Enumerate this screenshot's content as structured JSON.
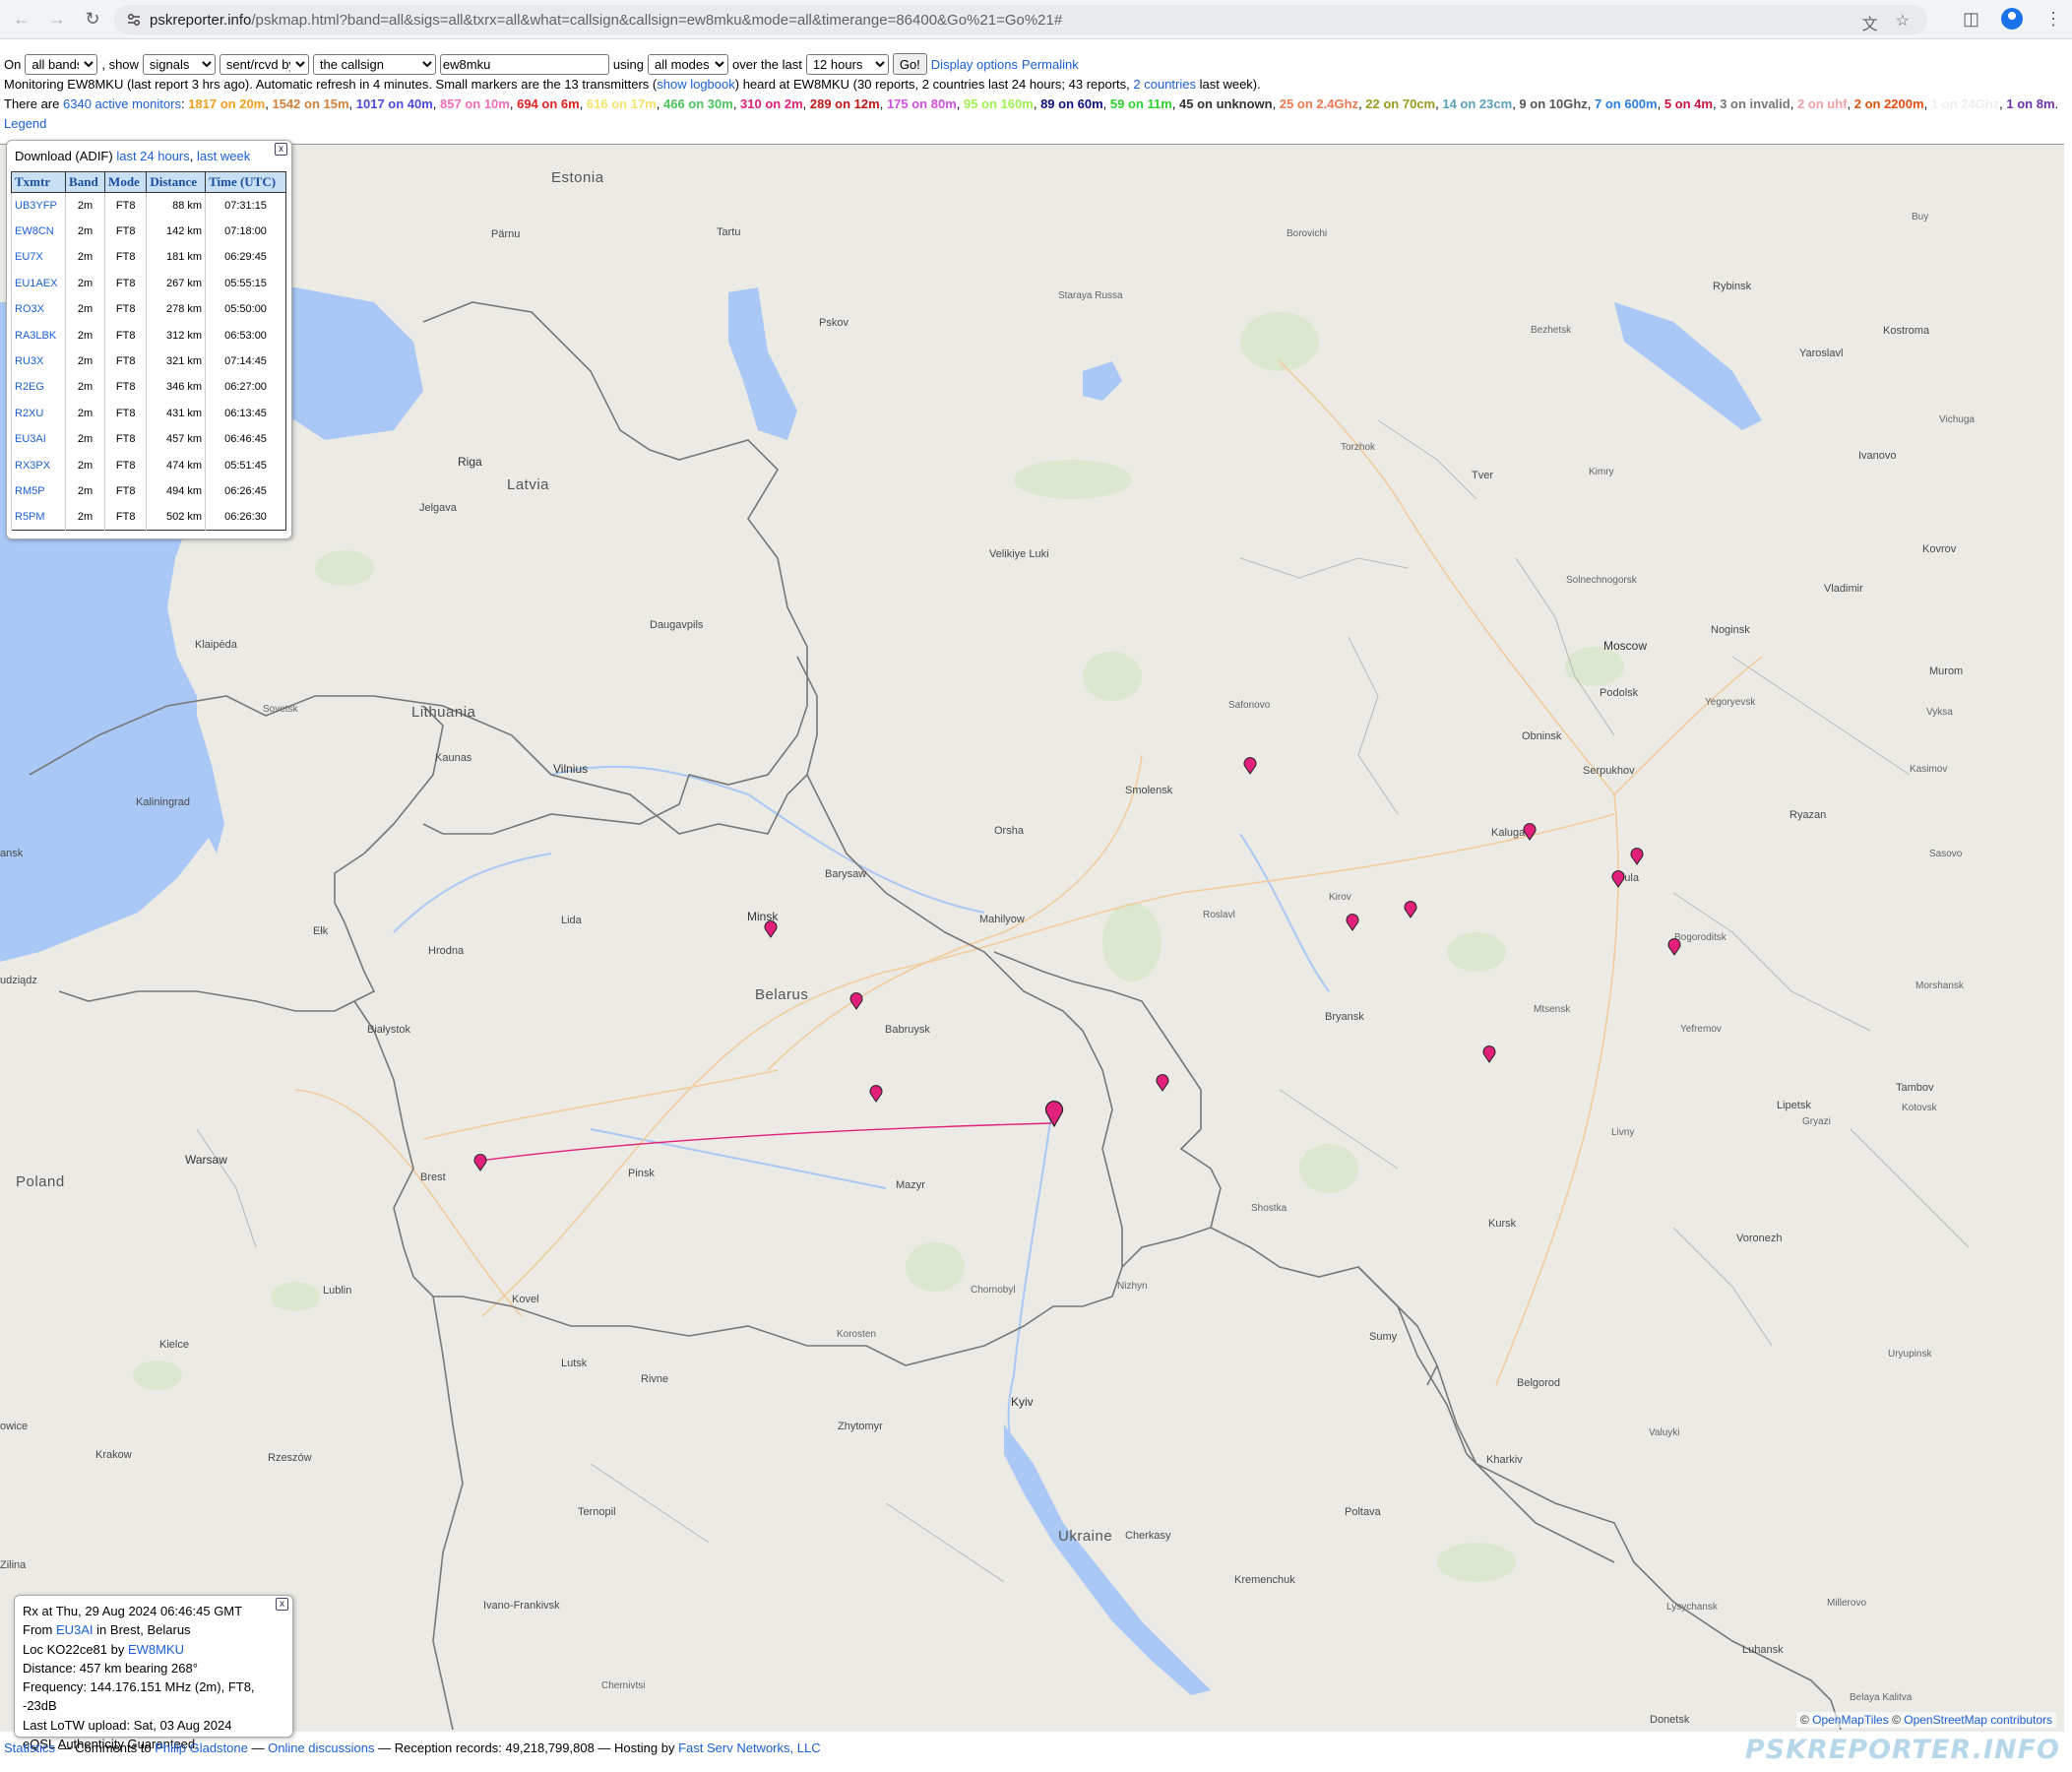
{
  "browser": {
    "url_host": "pskreporter.info",
    "url_path": "/pskmap.html?band=all&sigs=all&txrx=all&what=callsign&callsign=ew8mku&mode=all&timerange=86400&Go%21=Go%21#"
  },
  "controls": {
    "on_label": "On",
    "band_value": "all bands",
    "show_label": ", show",
    "sigs_value": "signals",
    "txrx_value": "sent/rcvd by",
    "what_value": "the callsign",
    "callsign_value": "ew8mku",
    "using_label": "using",
    "mode_value": "all modes",
    "over_label": "over the last",
    "timerange_value": "12 hours",
    "go_label": "Go!",
    "display_options": "Display options",
    "permalink": "Permalink"
  },
  "status": {
    "monitoring_prefix": "Monitoring EW8MKU (last report 3 hrs ago). Automatic refresh in 4 minutes. Small markers are the 13 transmitters (",
    "show_logbook": "show logbook",
    "monitoring_mid": ") heard at EW8MKU (30 reports, 2 countries last 24 hours; 43 reports,",
    "countries_link": "2 countries",
    "monitoring_suffix": "last week).",
    "there_are": "There are",
    "active_monitors": "6340 active monitors",
    "legend": "Legend"
  },
  "band_counts": [
    {
      "text": "1817 on 20m",
      "color": "#f0a020"
    },
    {
      "text": "1542 on 15m",
      "color": "#d0803a"
    },
    {
      "text": "1017 on 40m",
      "color": "#4b4bd8"
    },
    {
      "text": "857 on 10m",
      "color": "#f06dbb"
    },
    {
      "text": "694 on 6m",
      "color": "#e02020"
    },
    {
      "text": "616 on 17m",
      "color": "#f3e36a"
    },
    {
      "text": "466 on 30m",
      "color": "#4cc25a"
    },
    {
      "text": "310 on 2m",
      "color": "#e0207a"
    },
    {
      "text": "289 on 12m",
      "color": "#c01818"
    },
    {
      "text": "175 on 80m",
      "color": "#d050e0"
    },
    {
      "text": "95 on 160m",
      "color": "#a0f050"
    },
    {
      "text": "89 on 60m",
      "color": "#101080"
    },
    {
      "text": "59 on 11m",
      "color": "#30d030"
    },
    {
      "text": "45 on unknown",
      "color": "#333333"
    },
    {
      "text": "25 on 2.4Ghz",
      "color": "#f07850"
    },
    {
      "text": "22 on 70cm",
      "color": "#9a9a20"
    },
    {
      "text": "14 on 23cm",
      "color": "#5aa0b8"
    },
    {
      "text": "9 on 10Ghz",
      "color": "#555555"
    },
    {
      "text": "7 on 600m",
      "color": "#2e7fe0"
    },
    {
      "text": "5 on 4m",
      "color": "#cc1040"
    },
    {
      "text": "3 on invalid",
      "color": "#777777"
    },
    {
      "text": "2 on uhf",
      "color": "#f0a0a8"
    },
    {
      "text": "2 on 2200m",
      "color": "#e05010"
    },
    {
      "text": "1 on 24Ghz",
      "color": "#eeeeee"
    },
    {
      "text": "1 on 8m",
      "color": "#7030b0"
    }
  ],
  "download_panel": {
    "label": "Download (ADIF)",
    "link_24h": "last 24 hours",
    "link_week": "last week",
    "close": "x",
    "columns": [
      "Txmtr",
      "Band",
      "Mode",
      "Distance",
      "Time (UTC)"
    ],
    "rows": [
      [
        "UB3YFP",
        "2m",
        "FT8",
        "88 km",
        "07:31:15"
      ],
      [
        "EW8CN",
        "2m",
        "FT8",
        "142 km",
        "07:18:00"
      ],
      [
        "EU7X",
        "2m",
        "FT8",
        "181 km",
        "06:29:45"
      ],
      [
        "EU1AEX",
        "2m",
        "FT8",
        "267 km",
        "05:55:15"
      ],
      [
        "RO3X",
        "2m",
        "FT8",
        "278 km",
        "05:50:00"
      ],
      [
        "RA3LBK",
        "2m",
        "FT8",
        "312 km",
        "06:53:00"
      ],
      [
        "RU3X",
        "2m",
        "FT8",
        "321 km",
        "07:14:45"
      ],
      [
        "R2EG",
        "2m",
        "FT8",
        "346 km",
        "06:27:00"
      ],
      [
        "R2XU",
        "2m",
        "FT8",
        "431 km",
        "06:13:45"
      ],
      [
        "EU3AI",
        "2m",
        "FT8",
        "457 km",
        "06:46:45"
      ],
      [
        "RX3PX",
        "2m",
        "FT8",
        "474 km",
        "05:51:45"
      ],
      [
        "RM5P",
        "2m",
        "FT8",
        "494 km",
        "06:26:45"
      ],
      [
        "R5PM",
        "2m",
        "FT8",
        "502 km",
        "06:26:30"
      ]
    ]
  },
  "map": {
    "labels": {
      "estonia": "Estonia",
      "latvia": "Latvia",
      "lithuania": "Lithuania",
      "belarus": "Belarus",
      "poland": "Poland",
      "ukraine": "Ukraine",
      "tartu": "Tartu",
      "parnu": "Pärnu",
      "pskov": "Pskov",
      "staraya": "Staraya Russa",
      "borovichi": "Borovichi",
      "rybinsk": "Rybinsk",
      "buy": "Buy",
      "bezhetsk": "Bezhetsk",
      "kostroma": "Kostroma",
      "yaroslavl": "Yaroslavl",
      "vichuga": "Vichuga",
      "torzhok": "Torzhok",
      "tver": "Tver",
      "kimry": "Kimry",
      "ivanovo": "Ivanovo",
      "riga": "Riga",
      "jelgava": "Jelgava",
      "velikiye": "Velikiye Luki",
      "solnech": "Solnechnogorsk",
      "vladimir": "Vladimir",
      "kovrov": "Kovrov",
      "daugavpils": "Daugavpils",
      "klaipeda": "Klaipėda",
      "moscow": "Moscow",
      "noginsk": "Noginsk",
      "podolsk": "Podolsk",
      "murom": "Murom",
      "yegoryevsk": "Yegoryevsk",
      "vyksa": "Vyksa",
      "sovetsk": "Sovetsk",
      "kaunas": "Kaunas",
      "safonovo": "Safonovo",
      "obninsk": "Obninsk",
      "vilnius": "Vilnius",
      "smolensk": "Smolensk",
      "serpukhov": "Serpukhov",
      "kasimov": "Kasimov",
      "kaliningrad": "Kaliningrad",
      "orsha": "Orsha",
      "kaluga": "Kaluga",
      "ryazan": "Ryazan",
      "sasovo": "Sasovo",
      "barysaw": "Barysaw",
      "kirov": "Kirov",
      "tula": "Tula",
      "minsk": "Minsk",
      "mahilyow": "Mahilyow",
      "lida": "Lida",
      "roslavl": "Roslavl",
      "elk": "Ełk",
      "hrodna": "Hrodna",
      "bogoroditsk": "Bogoroditsk",
      "morshansk": "Morshansk",
      "udziadz": "udziądz",
      "mtsensk": "Mtsensk",
      "bryansk": "Bryansk",
      "babruysk": "Babruysk",
      "bialystok": "Białystok",
      "yefremov": "Yefremov",
      "tambov": "Tambov",
      "lipetsk": "Lipetsk",
      "kotovsk": "Kotovsk",
      "gryazi": "Gryazi",
      "livny": "Livny",
      "warsaw": "Warsaw",
      "brest": "Brest",
      "pinsk": "Pinsk",
      "mazyr": "Mazyr",
      "shostka": "Shostka",
      "kursk": "Kursk",
      "voronezh": "Voronezh",
      "lublin": "Lublin",
      "chornobyl": "Chornobyl",
      "nizhyn": "Nizhyn",
      "kovel": "Kovel",
      "korosten": "Korosten",
      "kielce": "Kielce",
      "lutsk": "Lutsk",
      "sumy": "Sumy",
      "uryupinsk": "Uryupinsk",
      "rivne": "Rivne",
      "kyiv": "Kyiv",
      "belgorod": "Belgorod",
      "krakow": "Krakow",
      "zhytomyr": "Zhytomyr",
      "valuyki": "Valuyki",
      "rzeszow": "Rzeszów",
      "kharkiv": "Kharkiv",
      "ternopil": "Ternopil",
      "poltava": "Poltava",
      "cherkasy": "Cherkasy",
      "zilina": "Zilina",
      "ivano": "Ivano-Frankivsk",
      "kremenchuk": "Kremenchuk",
      "lysychansk": "Lysychansk",
      "millerovo": "Millerovo",
      "luhansk": "Luhansk",
      "chernivtsi": "Chernivtsi",
      "belaya": "Belaya Kalitva",
      "donetsk": "Donetsk",
      "ansk": "ansk",
      "owice": "owice"
    },
    "attribution_prefix": "©",
    "openmaptiles": "OpenMapTiles",
    "attribution_mid": "©",
    "osm": "OpenStreetMap contributors"
  },
  "rx_popup": {
    "close": "x",
    "line1": "Rx at Thu, 29 Aug 2024 06:46:45 GMT",
    "from_label": "From",
    "from_call": "EU3AI",
    "from_loc": "in Brest, Belarus",
    "loc_label": "Loc KO22ce81 by",
    "loc_call": "EW8MKU",
    "distance": "Distance: 457 km bearing 268°",
    "frequency": "Frequency: 144.176.151 MHz (2m), FT8, -23dB",
    "lotw": "Last LoTW upload: Sat, 03 Aug 2024",
    "eqsl": "eQSL Authenticity Guaranteed."
  },
  "footer": {
    "statistics": "Statistics",
    "comments": "— Comments to",
    "philip": "Philip Gladstone",
    "dash2": "—",
    "discussions": "Online discussions",
    "records": "— Reception records: 49,218,799,808 — Hosting by",
    "hosting": "Fast Serv Networks, LLC",
    "watermark": "PSKREPORTER.INFO"
  },
  "colors": {
    "marker": "#e0207a",
    "link": "#1a5fd6",
    "water": "#a9c8f5"
  }
}
